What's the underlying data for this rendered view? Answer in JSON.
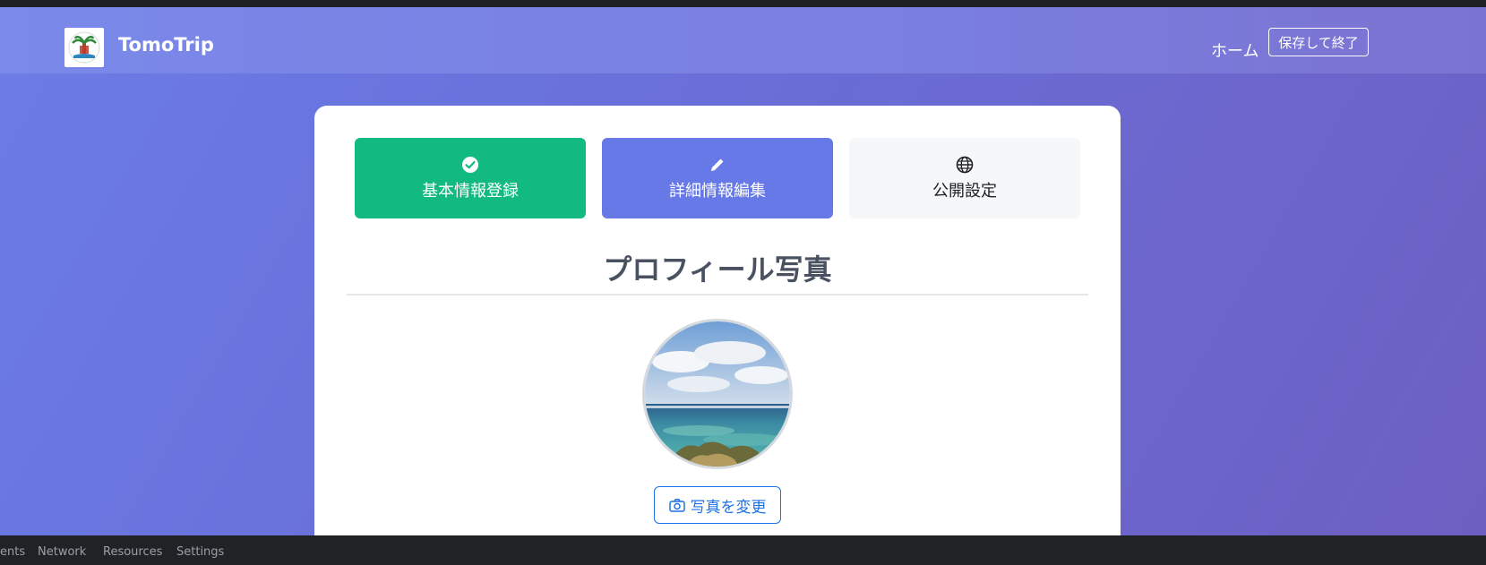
{
  "app": {
    "brand": "TomoTrip"
  },
  "nav": {
    "home": "ホーム",
    "save_exit": "保存して終了"
  },
  "steps": [
    {
      "label": "基本情報登録",
      "icon": "check-circle-icon",
      "color": "#12b981"
    },
    {
      "label": "詳細情報編集",
      "icon": "pencil-icon",
      "color": "#6779e7"
    },
    {
      "label": "公開設定",
      "icon": "globe-icon",
      "color": "#f6f7f9"
    }
  ],
  "section": {
    "title": "プロフィール写真"
  },
  "photo": {
    "change_label": "写真を変更"
  },
  "devtools": {
    "tabs": [
      "ents",
      "Network",
      "Resources",
      "Settings"
    ]
  }
}
